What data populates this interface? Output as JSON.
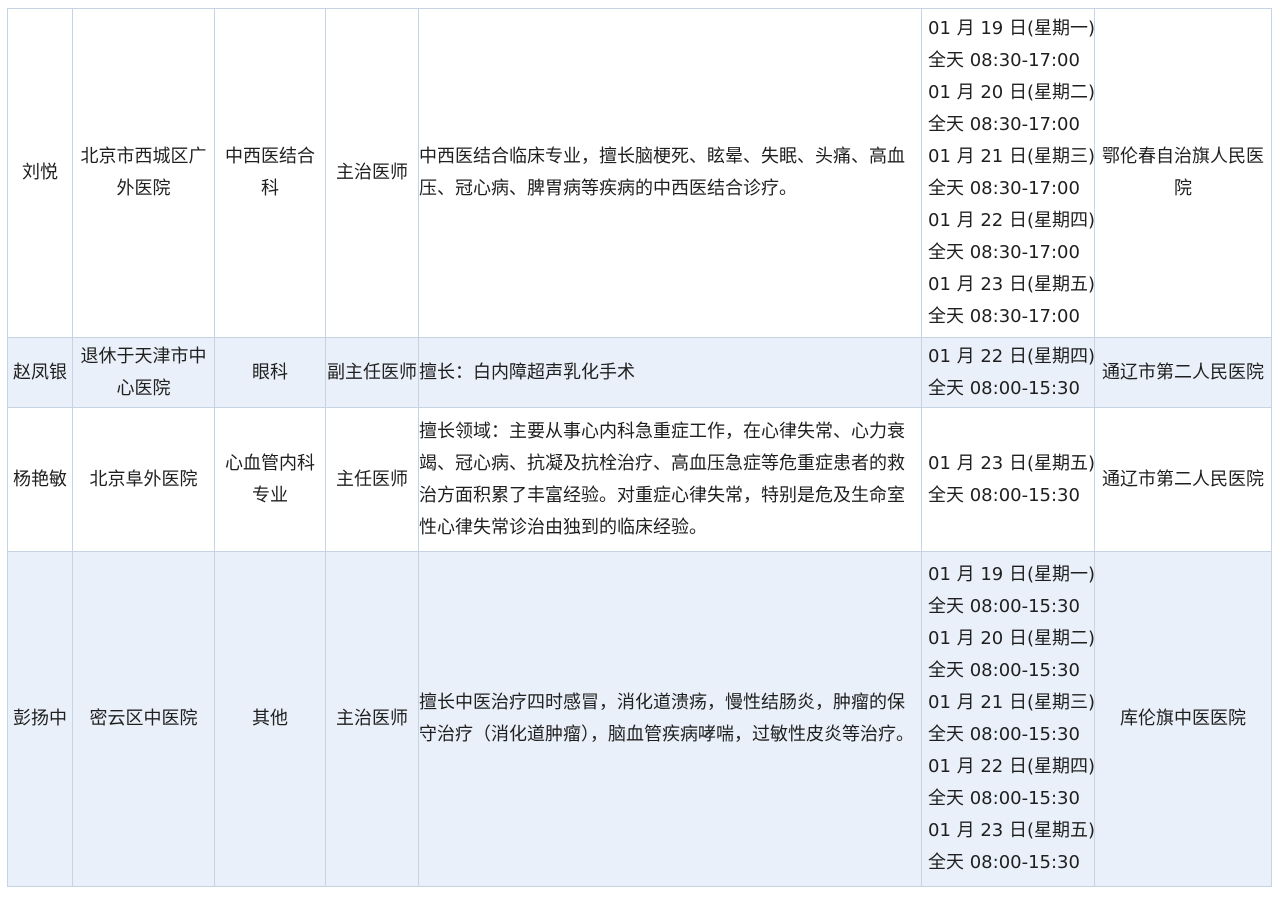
{
  "table": {
    "rows": [
      {
        "name": "刘悦",
        "hospital": "北京市西城区广外医院",
        "department": "中西医结合科",
        "title": "主治医师",
        "specialty": "中西医结合临床专业，擅长脑梗死、眩晕、失眠、头痛、高血压、冠心病、脾胃病等疾病的中西医结合诊疗。",
        "schedule": [
          "01 月 19 日(星期一)",
          "全天 08:30-17:00",
          "01 月 20 日(星期二)",
          "全天 08:30-17:00",
          "01 月 21 日(星期三)",
          "全天 08:30-17:00",
          "01 月 22 日(星期四)",
          "全天 08:30-17:00",
          "01 月 23 日(星期五)",
          "全天 08:30-17:00"
        ],
        "destination": "鄂伦春自治旗人民医院"
      },
      {
        "name": "赵凤银",
        "hospital": "退休于天津市中心医院",
        "department": "眼科",
        "title": "副主任医师",
        "specialty": "擅长：白内障超声乳化手术",
        "schedule": [
          "01 月 22 日(星期四)",
          "全天 08:00-15:30"
        ],
        "destination": "通辽市第二人民医院"
      },
      {
        "name": "杨艳敏",
        "hospital": "北京阜外医院",
        "department": "心血管内科专业",
        "title": "主任医师",
        "specialty": "擅长领域：主要从事心内科急重症工作，在心律失常、心力衰竭、冠心病、抗凝及抗栓治疗、高血压急症等危重症患者的救治方面积累了丰富经验。对重症心律失常，特别是危及生命室性心律失常诊治由独到的临床经验。",
        "schedule": [
          "01 月 23 日(星期五)",
          "全天 08:00-15:30"
        ],
        "destination": "通辽市第二人民医院"
      },
      {
        "name": "彭扬中",
        "hospital": "密云区中医院",
        "department": "其他",
        "title": "主治医师",
        "specialty": "擅长中医治疗四时感冒，消化道溃疡，慢性结肠炎，肿瘤的保守治疗（消化道肿瘤），脑血管疾病哮喘，过敏性皮炎等治疗。",
        "schedule": [
          "01 月 19 日(星期一)",
          "全天 08:00-15:30",
          "01 月 20 日(星期二)",
          "全天 08:00-15:30",
          "01 月 21 日(星期三)",
          "全天 08:00-15:30",
          "01 月 22 日(星期四)",
          "全天 08:00-15:30",
          "01 月 23 日(星期五)",
          "全天 08:00-15:30"
        ],
        "destination": "库伦旗中医医院"
      }
    ]
  },
  "colors": {
    "border": "#c5d3e2",
    "row_alt": "#eaf0f9",
    "text": "#1f1f1f"
  }
}
